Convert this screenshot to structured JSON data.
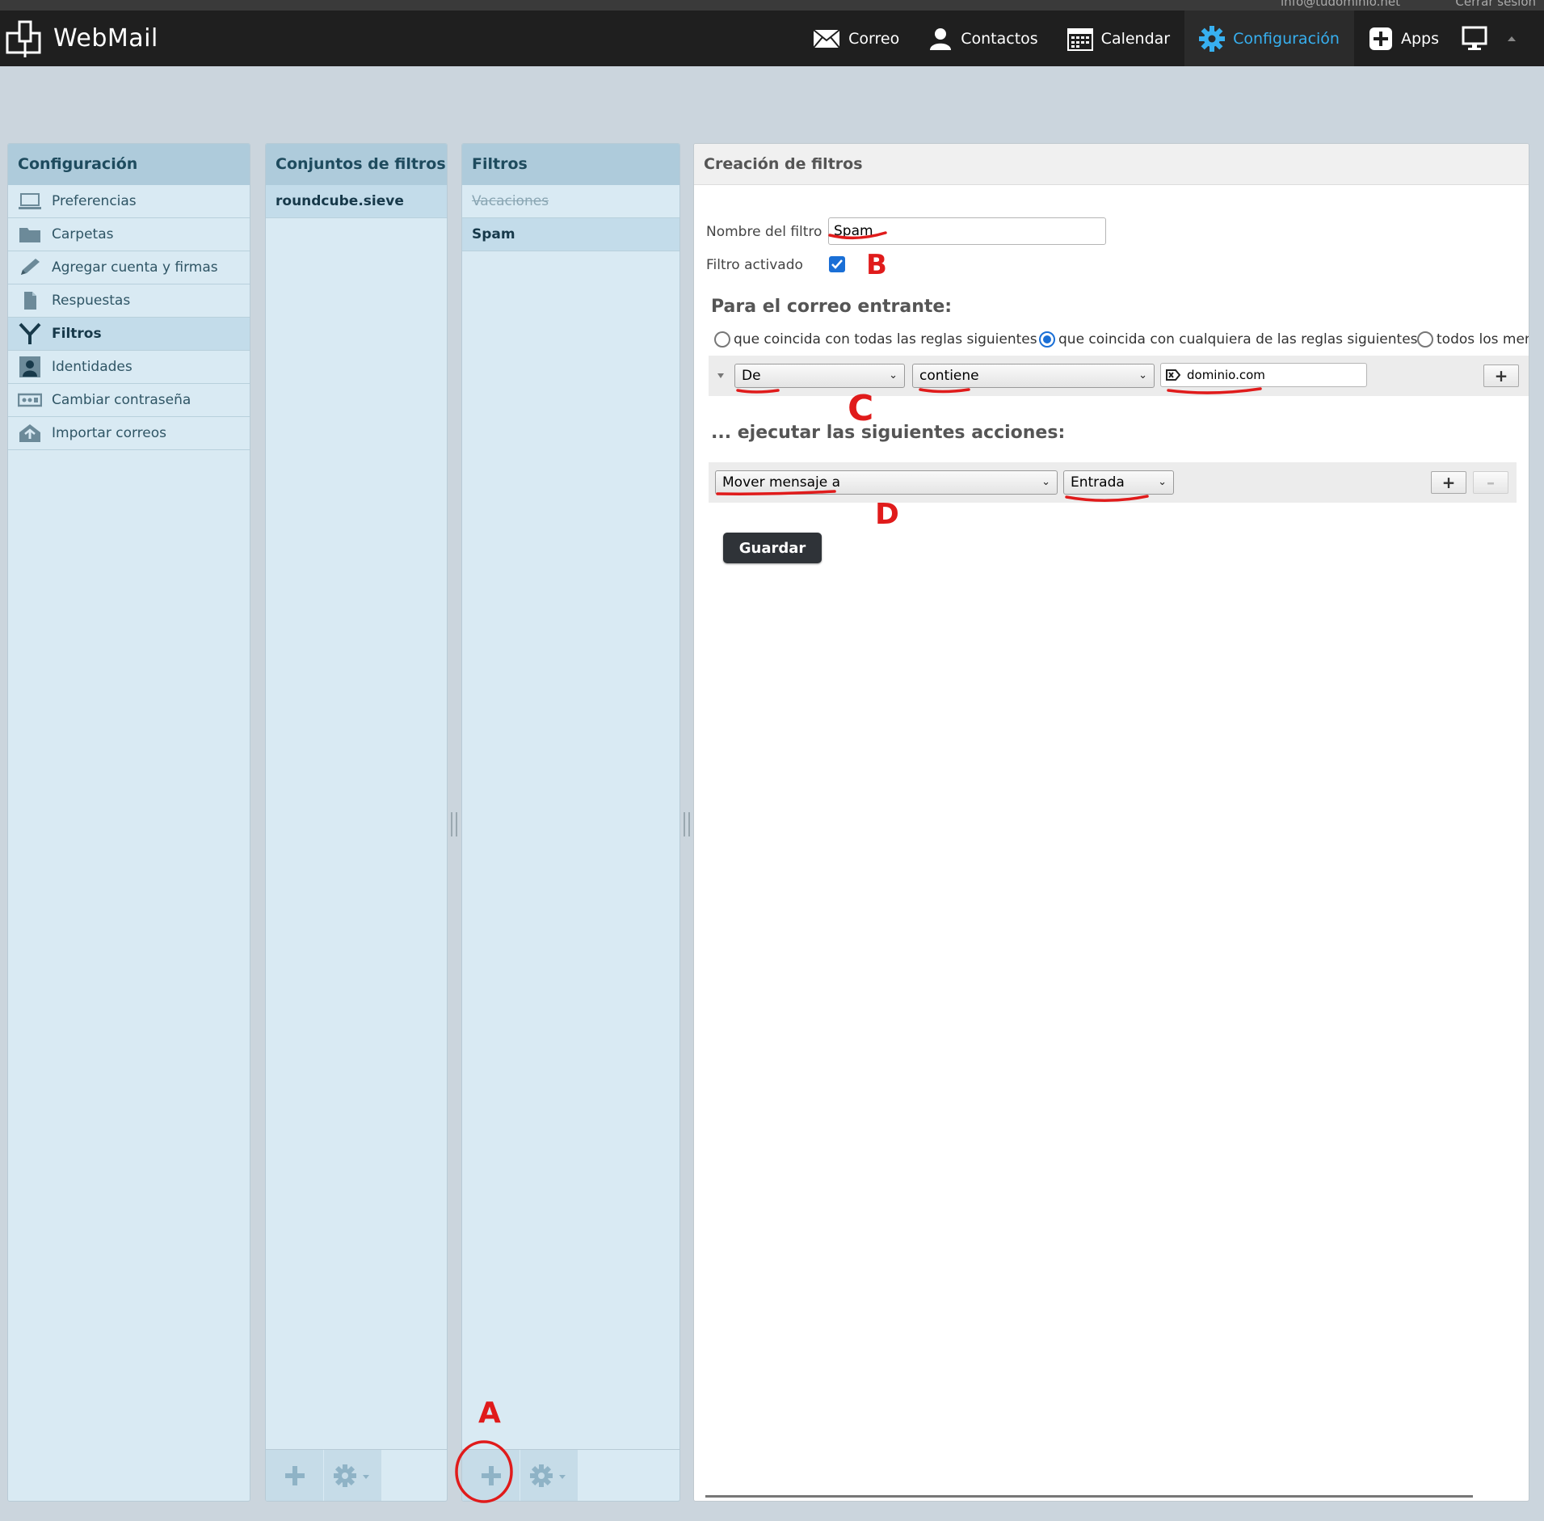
{
  "topline": {
    "user": "info@tudominio.net",
    "logout": "Cerrar sesión"
  },
  "app": {
    "title": "WebMail"
  },
  "nav": [
    {
      "label": "Correo",
      "icon": "envelope-icon"
    },
    {
      "label": "Contactos",
      "icon": "person-icon"
    },
    {
      "label": "Calendar",
      "icon": "calendar-icon"
    },
    {
      "label": "Configuración",
      "icon": "gear-icon",
      "active": true
    },
    {
      "label": "Apps",
      "icon": "plus-square-icon"
    }
  ],
  "colors": {
    "accent": "#37b0f0",
    "panel_header": "#aecbdb",
    "panel_bg": "#d9eaf3",
    "annotation": "#e01b1b"
  },
  "settings_panel": {
    "title": "Configuración",
    "items": [
      {
        "label": "Preferencias",
        "icon": "monitor-icon"
      },
      {
        "label": "Carpetas",
        "icon": "folder-icon"
      },
      {
        "label": "Agregar cuenta y firmas",
        "icon": "pencil-icon"
      },
      {
        "label": "Respuestas",
        "icon": "document-icon"
      },
      {
        "label": "Filtros",
        "icon": "filter-icon",
        "selected": true
      },
      {
        "label": "Identidades",
        "icon": "identity-icon"
      },
      {
        "label": "Cambiar contraseña",
        "icon": "password-icon"
      },
      {
        "label": "Importar correos",
        "icon": "import-icon"
      }
    ]
  },
  "filtersets_panel": {
    "title": "Conjuntos de filtros",
    "items": [
      {
        "label": "roundcube.sieve"
      }
    ]
  },
  "filters_panel": {
    "title": "Filtros",
    "items": [
      {
        "label": "Vacaciones",
        "disabled": true
      },
      {
        "label": "Spam",
        "selected": true
      }
    ]
  },
  "editor": {
    "title": "Creación de filtros",
    "name_label": "Nombre del filtro",
    "name_value": "Spam",
    "enabled_label": "Filtro activado",
    "enabled": true,
    "incoming_title": "Para el correo entrante:",
    "match_options": [
      {
        "label": "que coincida con todas las reglas siguientes",
        "checked": false
      },
      {
        "label": "que coincida con cualquiera de las reglas siguientes",
        "checked": true
      },
      {
        "label": "todos los men",
        "checked": false
      }
    ],
    "rule": {
      "header": "De",
      "operator": "contiene",
      "value": "dominio.com"
    },
    "actions_title": "... ejecutar las siguientes acciones:",
    "action": {
      "type": "Mover mensaje a",
      "folder": "Entrada"
    },
    "save_label": "Guardar"
  },
  "annotations": {
    "a": "A",
    "b": "B",
    "c": "C",
    "d": "D"
  }
}
